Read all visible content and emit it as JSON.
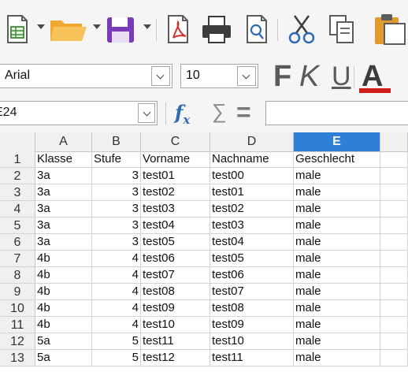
{
  "toolbar": {
    "font_name": "Arial",
    "font_size": "10",
    "bold_label": "F",
    "italic_label": "K",
    "underline_label": "U",
    "font_color_label": "A",
    "font_color": "#d21d1d"
  },
  "formula_bar": {
    "name_box": "E24",
    "formula": ""
  },
  "grid": {
    "columns": [
      "A",
      "B",
      "C",
      "D",
      "E"
    ],
    "selected_column": "E",
    "rows": [
      {
        "n": "1",
        "cells": [
          "Klasse",
          "Stufe",
          "Vorname",
          "Nachname",
          "Geschlecht"
        ]
      },
      {
        "n": "2",
        "cells": [
          "3a",
          "3",
          "test01",
          "test00",
          "male"
        ]
      },
      {
        "n": "3",
        "cells": [
          "3a",
          "3",
          "test02",
          "test01",
          "male"
        ]
      },
      {
        "n": "4",
        "cells": [
          "3a",
          "3",
          "test03",
          "test02",
          "male"
        ]
      },
      {
        "n": "5",
        "cells": [
          "3a",
          "3",
          "test04",
          "test03",
          "male"
        ]
      },
      {
        "n": "6",
        "cells": [
          "3a",
          "3",
          "test05",
          "test04",
          "male"
        ]
      },
      {
        "n": "7",
        "cells": [
          "4b",
          "4",
          "test06",
          "test05",
          "male"
        ]
      },
      {
        "n": "8",
        "cells": [
          "4b",
          "4",
          "test07",
          "test06",
          "male"
        ]
      },
      {
        "n": "9",
        "cells": [
          "4b",
          "4",
          "test08",
          "test07",
          "male"
        ]
      },
      {
        "n": "10",
        "cells": [
          "4b",
          "4",
          "test09",
          "test08",
          "male"
        ]
      },
      {
        "n": "11",
        "cells": [
          "4b",
          "4",
          "test10",
          "test09",
          "male"
        ]
      },
      {
        "n": "12",
        "cells": [
          "5a",
          "5",
          "test11",
          "test10",
          "male"
        ]
      },
      {
        "n": "13",
        "cells": [
          "5a",
          "5",
          "test12",
          "test11",
          "male"
        ]
      }
    ]
  }
}
